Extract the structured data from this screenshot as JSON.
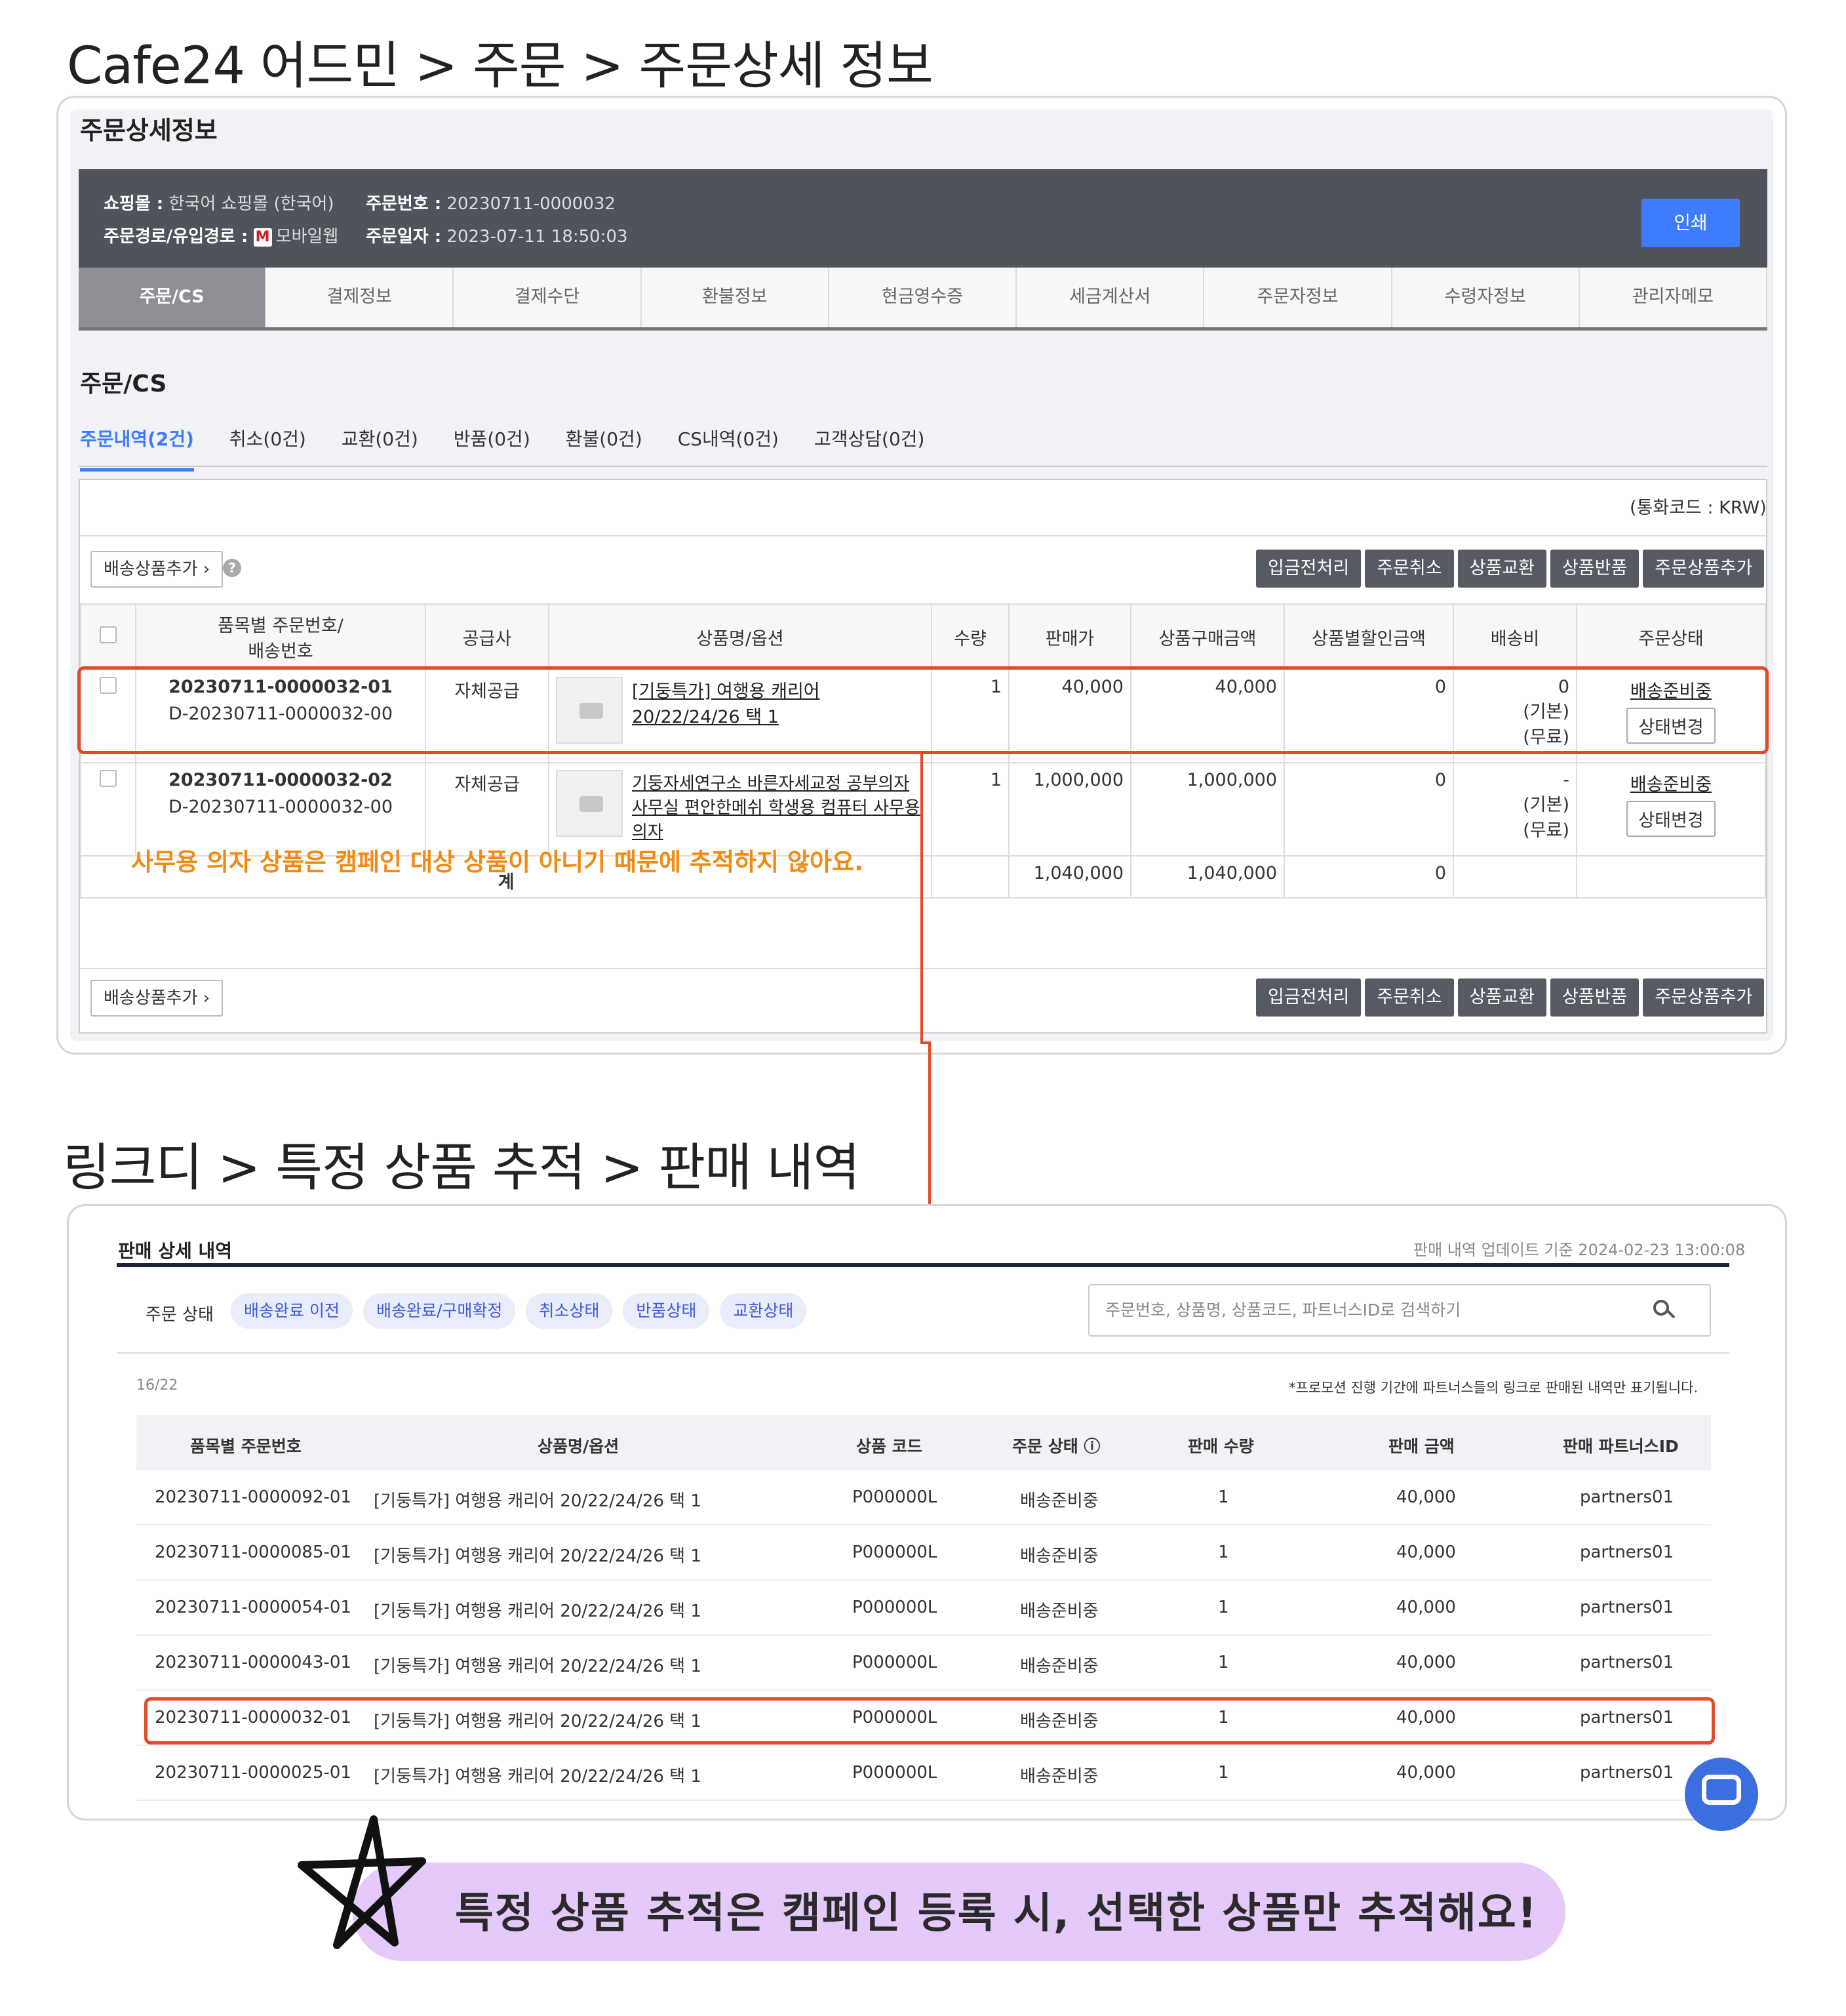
{
  "heading1": "Cafe24 어드민 > 주문 > 주문상세 정보",
  "heading2": "링크디 > 특정 상품 추적 > 판매 내역",
  "cafe24": {
    "panel_title": "주문상세정보",
    "info": {
      "mall_label": "쇼핑몰 :",
      "mall_value": "한국어 쇼핑몰 (한국어)",
      "route_label": "주문경로/유입경로 :",
      "route_value": "모바일웹",
      "route_badge": "M",
      "order_no_label": "주문번호 :",
      "order_no_value": "20230711-0000032",
      "order_date_label": "주문일자 :",
      "order_date_value": "2023-07-11 18:50:03"
    },
    "print_button": "인쇄",
    "tabs": [
      "주문/CS",
      "결제정보",
      "결제수단",
      "환불정보",
      "현금영수증",
      "세금계산서",
      "주문자정보",
      "수령자정보",
      "관리자메모"
    ],
    "section_title": "주문/CS",
    "subtabs": [
      "주문내역(2건)",
      "취소(0건)",
      "교환(0건)",
      "반품(0건)",
      "환불(0건)",
      "CS내역(0건)",
      "고객상담(0건)"
    ],
    "currency": "(통화코드 : KRW)",
    "add_shipping_item": "배송상품추가 ›",
    "help_icon": "?",
    "actions": [
      "입금전처리",
      "주문취소",
      "상품교환",
      "상품반품",
      "주문상품추가"
    ],
    "columns": [
      "품목별 주문번호/\n배송번호",
      "공급사",
      "상품명/옵션",
      "수량",
      "판매가",
      "상품구매금액",
      "상품별할인금액",
      "배송비",
      "주문상태"
    ],
    "rows": [
      {
        "order_no": "20230711-0000032-01",
        "ship_no": "D-20230711-0000032-00",
        "supplier": "자체공급",
        "product": "[기둥특가] 여행용 캐리어 20/22/24/26 택 1",
        "qty": "1",
        "price": "40,000",
        "amount": "40,000",
        "discount": "0",
        "shipping": "0",
        "ship_basic": "(기본)",
        "ship_free": "(무료)",
        "status": "배송준비중",
        "status_btn": "상태변경"
      },
      {
        "order_no": "20230711-0000032-02",
        "ship_no": "D-20230711-0000032-00",
        "supplier": "자체공급",
        "product": "기둥자세연구소 바른자세교정 공부의자 사무실 편안한메쉬 학생용 컴퓨터 사무용 의자",
        "qty": "1",
        "price": "1,000,000",
        "amount": "1,000,000",
        "discount": "0",
        "shipping": "-",
        "ship_basic": "(기본)",
        "ship_free": "(무료)",
        "status": "배송준비중",
        "status_btn": "상태변경"
      }
    ],
    "total": {
      "label": "계",
      "price": "1,040,000",
      "amount": "1,040,000",
      "discount": "0"
    },
    "note": "사무용 의자 상품은 캠페인 대상 상품이 아니기 때문에 추적하지 않아요."
  },
  "linkd": {
    "title": "판매 상세 내역",
    "update": "판매 내역 업데이트 기준 2024-02-23 13:00:08",
    "status_label": "주문 상태",
    "chips": [
      "배송완료 이전",
      "배송완료/구매확정",
      "취소상태",
      "반품상태",
      "교환상태"
    ],
    "search_placeholder": "주문번호, 상품명, 상품코드, 파트너스ID로 검색하기",
    "count": "16/22",
    "note": "*프로모션 진행 기간에 파트너스들의 링크로 판매된 내역만 표기됩니다.",
    "columns": [
      "품목별 주문번호",
      "상품명/옵션",
      "상품 코드",
      "주문 상태 ⓘ",
      "판매 수량",
      "판매 금액",
      "판매 파트너스ID"
    ],
    "rows": [
      {
        "order": "20230711-0000092-01",
        "product": "[기둥특가] 여행용 캐리어 20/22/24/26 택 1",
        "code": "P000000L",
        "status": "배송준비중",
        "qty": "1",
        "amount": "40,000",
        "partner": "partners01"
      },
      {
        "order": "20230711-0000085-01",
        "product": "[기둥특가] 여행용 캐리어 20/22/24/26 택 1",
        "code": "P000000L",
        "status": "배송준비중",
        "qty": "1",
        "amount": "40,000",
        "partner": "partners01"
      },
      {
        "order": "20230711-0000054-01",
        "product": "[기둥특가] 여행용 캐리어 20/22/24/26 택 1",
        "code": "P000000L",
        "status": "배송준비중",
        "qty": "1",
        "amount": "40,000",
        "partner": "partners01"
      },
      {
        "order": "20230711-0000043-01",
        "product": "[기둥특가] 여행용 캐리어 20/22/24/26 택 1",
        "code": "P000000L",
        "status": "배송준비중",
        "qty": "1",
        "amount": "40,000",
        "partner": "partners01"
      },
      {
        "order": "20230711-0000032-01",
        "product": "[기둥특가] 여행용 캐리어 20/22/24/26 택 1",
        "code": "P000000L",
        "status": "배송준비중",
        "qty": "1",
        "amount": "40,000",
        "partner": "partners01"
      },
      {
        "order": "20230711-0000025-01",
        "product": "[기둥특가] 여행용 캐리어 20/22/24/26 택 1",
        "code": "P000000L",
        "status": "배송준비중",
        "qty": "1",
        "amount": "40,000",
        "partner": "partners01"
      }
    ]
  },
  "banner": "특정 상품 추적은 캠페인 등록 시, 선택한 상품만 추적해요!",
  "colors": {
    "accent_blue": "#3d7bff",
    "highlight_red": "#e24a2b",
    "note_orange": "#f08a14",
    "banner_purple": "#e5c9fa"
  }
}
